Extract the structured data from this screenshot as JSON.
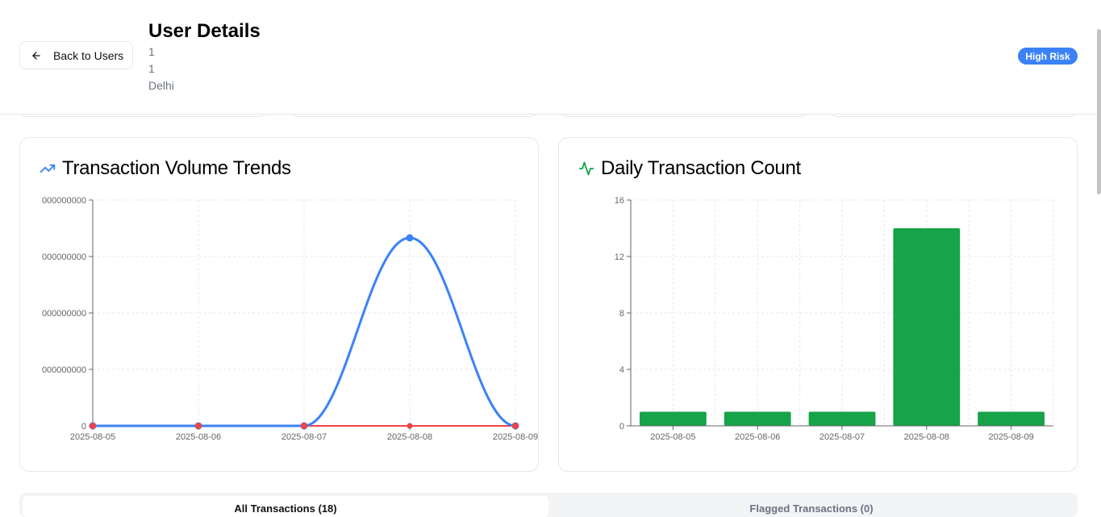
{
  "header": {
    "back_label": "Back to Users",
    "title": "User Details",
    "meta": [
      "1",
      "1",
      "Delhi"
    ],
    "risk_badge": "High Risk",
    "risk_color": "#3b82f6"
  },
  "volume_card": {
    "title": "Transaction Volume Trends",
    "icon": "trending-up-icon"
  },
  "count_card": {
    "title": "Daily Transaction Count",
    "icon": "activity-icon"
  },
  "tabs": {
    "all": "All Transactions (18)",
    "flagged": "Flagged Transactions (0)"
  },
  "chart_data": [
    {
      "type": "line",
      "title": "Transaction Volume Trends",
      "categories": [
        "2025-08-05",
        "2025-08-06",
        "2025-08-07",
        "2025-08-08",
        "2025-08-09"
      ],
      "y_tick_labels": [
        "0",
        "000000000",
        "000000000",
        "000000000",
        "000000000"
      ],
      "ylim": [
        0,
        4
      ],
      "series": [
        {
          "color": "#3b82f6",
          "values": [
            0,
            0,
            0,
            3.33,
            0
          ]
        },
        {
          "color": "#ef4444",
          "values": [
            0,
            0,
            0,
            0,
            0
          ]
        }
      ],
      "grid": true
    },
    {
      "type": "bar",
      "title": "Daily Transaction Count",
      "categories": [
        "2025-08-05",
        "2025-08-06",
        "2025-08-07",
        "2025-08-08",
        "2025-08-09"
      ],
      "values": [
        1,
        1,
        1,
        14,
        1
      ],
      "y_ticks": [
        "0",
        "4",
        "8",
        "12",
        "16"
      ],
      "ylim": [
        0,
        16
      ],
      "color": "#16a34a",
      "grid": true
    }
  ]
}
